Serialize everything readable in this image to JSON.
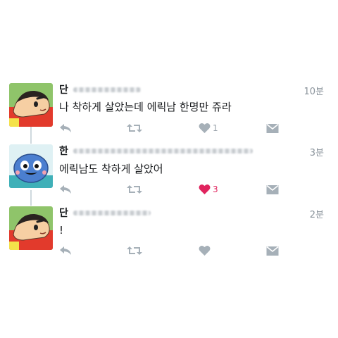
{
  "colors": {
    "icon_gray": "#a6b0b8",
    "like_red": "#e0245e",
    "thread_line": "#cfd9de",
    "text": "#1a1c1f",
    "meta": "#8a939b"
  },
  "tweets": [
    {
      "name": "단",
      "time": "10분",
      "text": "나 착하게 살았는데 에릭남 한명만 쥬라",
      "likes": "1",
      "liked": false,
      "avatar": "cartoon-boy-avatar"
    },
    {
      "name": "한",
      "time": "3분",
      "text": "에릭남도 착하게 살았어",
      "likes": "3",
      "liked": true,
      "avatar": "blue-character-avatar"
    },
    {
      "name": "단",
      "time": "2분",
      "text": "!",
      "likes": "",
      "liked": false,
      "avatar": "cartoon-boy-avatar"
    }
  ],
  "icons": [
    "reply-icon",
    "retweet-icon",
    "like-icon",
    "dm-icon"
  ]
}
